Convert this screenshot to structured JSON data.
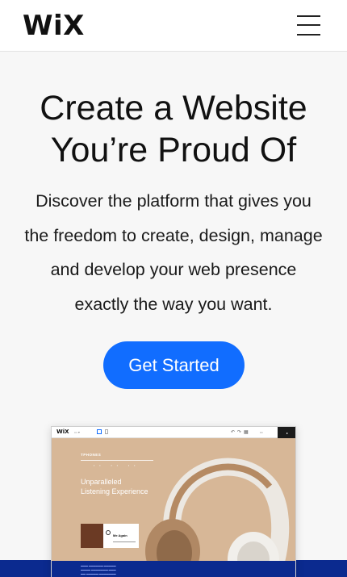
{
  "header": {
    "logo": "WiX",
    "menu_icon": "hamburger-menu-icon"
  },
  "hero": {
    "title_line1": "Create a Website",
    "title_line2": "You’re Proud Of",
    "text_line1": "Discover the platform that gives you",
    "text_line2": "the freedom to create, design, manage",
    "text_line3": "and develop your web presence",
    "text_line4": "exactly the way you want.",
    "cta_label": "Get Started"
  },
  "mockup": {
    "logo": "WiX",
    "brand": "TPHONES",
    "headline_line1": "Unparalleled",
    "headline_line2": "Listening Experience",
    "card_song": "Me Again"
  },
  "colors": {
    "accent": "#116dff",
    "band": "#0b2a8f",
    "mockup_bg": "#d7b797"
  }
}
